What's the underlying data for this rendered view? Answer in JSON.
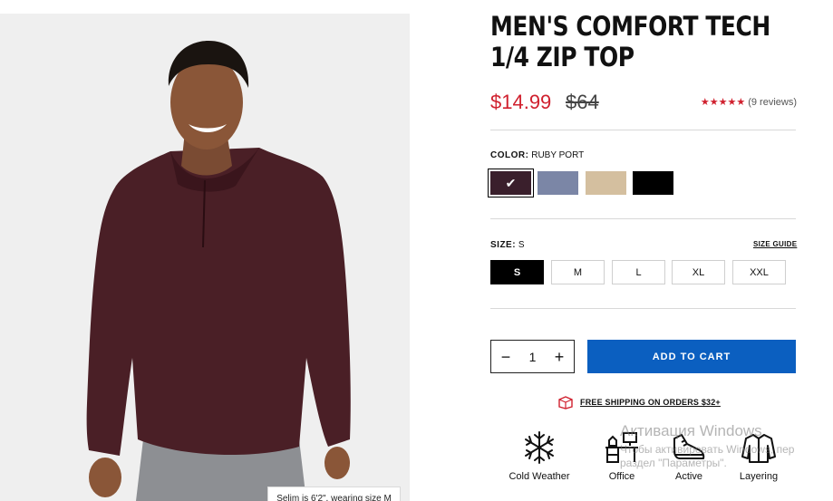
{
  "product": {
    "title": "MEN'S COMFORT TECH 1/4 ZIP TOP",
    "price_sale": "$14.99",
    "price_original": "$64",
    "rating_stars": "★★★★★",
    "reviews": "(9 reviews)"
  },
  "image": {
    "caption": "Selim is 6'2\", wearing size M"
  },
  "color": {
    "label": "COLOR:",
    "selected_name": "RUBY PORT",
    "swatches": [
      {
        "name": "ruby-port",
        "hex": "#3a1f2c",
        "selected": true
      },
      {
        "name": "slate-blue",
        "hex": "#7b86a6",
        "selected": false
      },
      {
        "name": "tan",
        "hex": "#d4bf9f",
        "selected": false
      },
      {
        "name": "black",
        "hex": "#000000",
        "selected": false
      }
    ]
  },
  "size": {
    "label": "SIZE:",
    "selected": "S",
    "guide_label": "SIZE GUIDE",
    "options": [
      "S",
      "M",
      "L",
      "XL",
      "XXL"
    ]
  },
  "cart": {
    "quantity": "1",
    "minus": "−",
    "plus": "+",
    "add_label": "ADD TO CART"
  },
  "shipping": {
    "text": "FREE SHIPPING ON ORDERS $32+"
  },
  "features": [
    {
      "label": "Cold Weather",
      "icon": "snowflake-icon"
    },
    {
      "label": "Office",
      "icon": "desk-icon"
    },
    {
      "label": "Active",
      "icon": "sneaker-icon"
    },
    {
      "label": "Layering",
      "icon": "jacket-icon"
    }
  ],
  "os_watermark": {
    "line1": "Активация Windows",
    "line2": "Чтобы активировать Windows, пер",
    "line3": "раздел \"Параметры\"."
  },
  "colors": {
    "accent_red": "#d0202e",
    "button_blue": "#0b5fc0"
  }
}
